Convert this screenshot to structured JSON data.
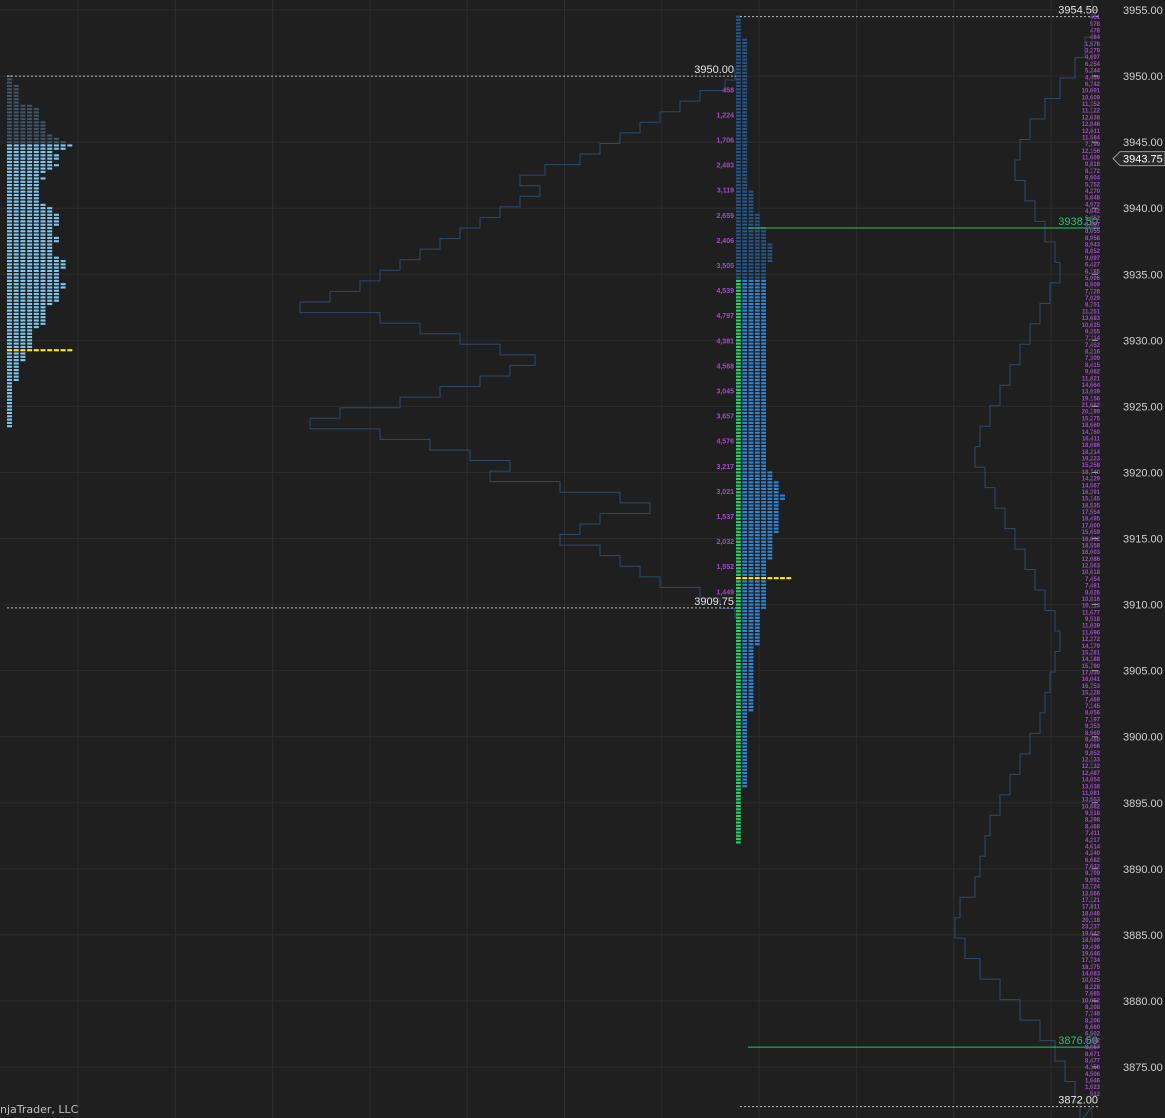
{
  "app": {
    "credit": "njaTrader, LLC"
  },
  "chart_data": {
    "type": "profile",
    "price_axis": {
      "min": 3871.5,
      "max": 3955.5,
      "tick_step": 5,
      "ticks": [
        "3955.00",
        "3950.00",
        "3945.00",
        "3940.00",
        "3935.00",
        "3930.00",
        "3925.00",
        "3920.00",
        "3915.00",
        "3910.00",
        "3905.00",
        "3900.00",
        "3895.00",
        "3890.00",
        "3885.00",
        "3880.00",
        "3875.00"
      ],
      "current_price": "3943.75"
    },
    "grid": true,
    "colors": {
      "background": "#1f1f1f",
      "grid": "#2d2d2d",
      "tpo_dim": "#3f5566",
      "tpo_value_area_left": "#7ec7f0",
      "tpo_value_area_right": "#2f86d6",
      "tpo_dim_right": "#23568a",
      "tpo_letters": "#1fd66a",
      "tpo_letters_dim": "#1b7a4a",
      "poc": "#ffee00",
      "volume_outline": "#2e4a6a",
      "volume_labels": "#a349c9",
      "level_line": "#22c76a",
      "range_line": "#bbbbbb"
    },
    "left_profile": {
      "high": 3950.0,
      "low": 3909.75,
      "high_label": "3950.00",
      "low_label": "3909.75",
      "poc_price": 3929.25,
      "value_area_high": 3944.75,
      "value_area_low": 3920.0,
      "tpo_counts": [
        1,
        1,
        1,
        2,
        2,
        2,
        2,
        2,
        2,
        4,
        5,
        5,
        5,
        5,
        6,
        6,
        6,
        6,
        7,
        8,
        9,
        10,
        9,
        7,
        8,
        8,
        7,
        8,
        7,
        6,
        5,
        6,
        5,
        5,
        5,
        5,
        5,
        5,
        5,
        6,
        7,
        7,
        8,
        8,
        8,
        8,
        7,
        7,
        7,
        8,
        8,
        7,
        7,
        7,
        7,
        8,
        9,
        9,
        9,
        8,
        8,
        8,
        8,
        9,
        9,
        8,
        8,
        8,
        8,
        7,
        6,
        6,
        6,
        6,
        6,
        6,
        5,
        4,
        4,
        4,
        4,
        4,
        4,
        3,
        3,
        3,
        3,
        2,
        2,
        2,
        2,
        2,
        2,
        1,
        1,
        1,
        1,
        1,
        1,
        1,
        1,
        1,
        1,
        1,
        1,
        1,
        1
      ]
    },
    "left_volume_profile": {
      "labels": [
        "458",
        "1,224",
        "1,706",
        "2,483",
        "3,119",
        "2,659",
        "2,406",
        "3,505",
        "4,539",
        "4,797",
        "4,381",
        "4,568",
        "3,045",
        "3,657",
        "4,576",
        "3,217",
        "3,021",
        "1,537",
        "2,032",
        "1,552",
        "1,449"
      ]
    },
    "right_profile": {
      "high": 3954.5,
      "low": 3872.0,
      "high_label": "3954.50",
      "low_label": "3872.00",
      "poc_price": 3912.0,
      "level_high": "3938.50",
      "level_low": "3876.50",
      "level_high_value": 3938.5,
      "level_low_value": 3876.5,
      "tpo_counts": [
        1,
        1,
        1,
        1,
        1,
        1,
        1,
        2,
        2,
        2,
        2,
        2,
        2,
        2,
        2,
        2,
        2,
        2,
        2,
        2,
        2,
        2,
        2,
        2,
        2,
        2,
        2,
        2,
        2,
        2,
        2,
        2,
        2,
        2,
        2,
        2,
        2,
        2,
        2,
        2,
        2,
        2,
        2,
        2,
        2,
        2,
        2,
        2,
        2,
        2,
        2,
        2,
        2,
        3,
        3,
        3,
        3,
        3,
        3,
        3,
        4,
        4,
        4,
        4,
        5,
        5,
        5,
        5,
        5,
        6,
        6,
        6,
        6,
        6,
        6,
        5,
        5,
        5,
        5,
        5,
        5,
        5,
        5,
        5,
        5,
        5,
        5,
        5,
        5,
        5,
        5,
        5,
        5,
        5,
        5,
        5,
        5,
        5,
        5,
        5,
        5,
        5,
        5,
        5,
        5,
        5,
        5,
        5,
        5,
        5,
        5,
        5,
        5,
        5,
        5,
        5,
        5,
        5,
        5,
        5,
        5,
        5,
        5,
        5,
        5,
        5,
        5,
        5,
        5,
        5,
        5,
        5,
        5,
        5,
        5,
        5,
        5,
        5,
        6,
        6,
        6,
        7,
        7,
        7,
        7,
        8,
        8,
        7,
        7,
        7,
        7,
        7,
        7,
        7,
        7,
        7,
        7,
        6,
        6,
        6,
        6,
        6,
        6,
        6,
        6,
        5,
        5,
        5,
        5,
        5,
        5,
        5,
        5,
        5,
        5,
        5,
        5,
        5,
        5,
        5,
        4,
        4,
        4,
        4,
        4,
        4,
        4,
        4,
        4,
        4,
        4,
        3,
        3,
        3,
        3,
        3,
        3,
        3,
        3,
        3,
        3,
        3,
        3,
        3,
        3,
        3,
        3,
        3,
        3,
        3,
        3,
        2,
        2,
        2,
        2,
        2,
        2,
        2,
        2,
        2,
        2,
        2,
        2,
        2,
        2,
        2,
        2,
        2,
        2,
        2,
        2,
        2,
        2,
        2,
        1,
        1,
        1,
        1,
        1,
        1,
        1,
        1,
        1,
        1,
        1,
        1,
        1,
        1,
        1,
        1,
        1
      ]
    },
    "right_volume_profile": {
      "labels": [
        "461",
        "578",
        "478",
        "484",
        "1,576",
        "3,279",
        "4,697",
        "6,254",
        "5,244",
        "4,459",
        "6,742",
        "10,691",
        "10,609",
        "11,152",
        "11,122",
        "12,638",
        "12,846",
        "12,611",
        "11,584",
        "7,799",
        "12,156",
        "11,609",
        "9,816",
        "8,172",
        "6,904",
        "5,752",
        "4,270",
        "5,848",
        "4,972",
        "4,642",
        "5,352",
        "6,657",
        "8,055",
        "8,958",
        "8,943",
        "8,852",
        "9,097",
        "6,427",
        "6,185",
        "5,006",
        "6,909",
        "7,728",
        "7,029",
        "8,751",
        "11,251",
        "13,683",
        "10,635",
        "9,355",
        "7,114",
        "7,452",
        "8,216",
        "7,309",
        "8,415",
        "9,082",
        "11,821",
        "14,664",
        "13,939",
        "19,156",
        "21,682",
        "20,199",
        "15,275",
        "18,660",
        "14,760",
        "16,411",
        "18,086",
        "18,214",
        "19,223",
        "15,258",
        "18,740",
        "14,229",
        "14,567",
        "16,391",
        "15,145",
        "18,535",
        "17,554",
        "18,495",
        "17,000",
        "15,659",
        "16,632",
        "18,558",
        "16,003",
        "12,086",
        "12,563",
        "10,618",
        "7,454",
        "7,481",
        "8,026",
        "10,816",
        "10,113",
        "11,677",
        "9,518",
        "11,039",
        "11,696",
        "12,272",
        "14,179",
        "15,281",
        "14,188",
        "15,790",
        "17,030",
        "16,041",
        "16,753",
        "15,228",
        "7,469",
        "7,145",
        "8,056",
        "7,197",
        "9,353",
        "8,969",
        "9,480",
        "9,066",
        "9,852",
        "12,133",
        "12,132",
        "12,487",
        "14,054",
        "13,038",
        "11,081",
        "13,553",
        "10,882",
        "9,518",
        "8,298",
        "8,468",
        "7,411",
        "4,217",
        "4,614",
        "4,240",
        "6,682",
        "7,032",
        "9,709",
        "9,992",
        "12,724",
        "13,566",
        "17,121",
        "17,811",
        "18,048",
        "20,118",
        "23,237",
        "19,642",
        "18,599",
        "19,436",
        "19,646",
        "17,734",
        "18,375",
        "14,083",
        "10,025",
        "8,228",
        "7,685",
        "10,052",
        "8,208",
        "7,748",
        "8,206",
        "6,660",
        "6,502",
        "8,182",
        "8,667",
        "8,671",
        "8,477",
        "4,158",
        "4,506",
        "1,646",
        "1,023",
        "512"
      ]
    }
  }
}
